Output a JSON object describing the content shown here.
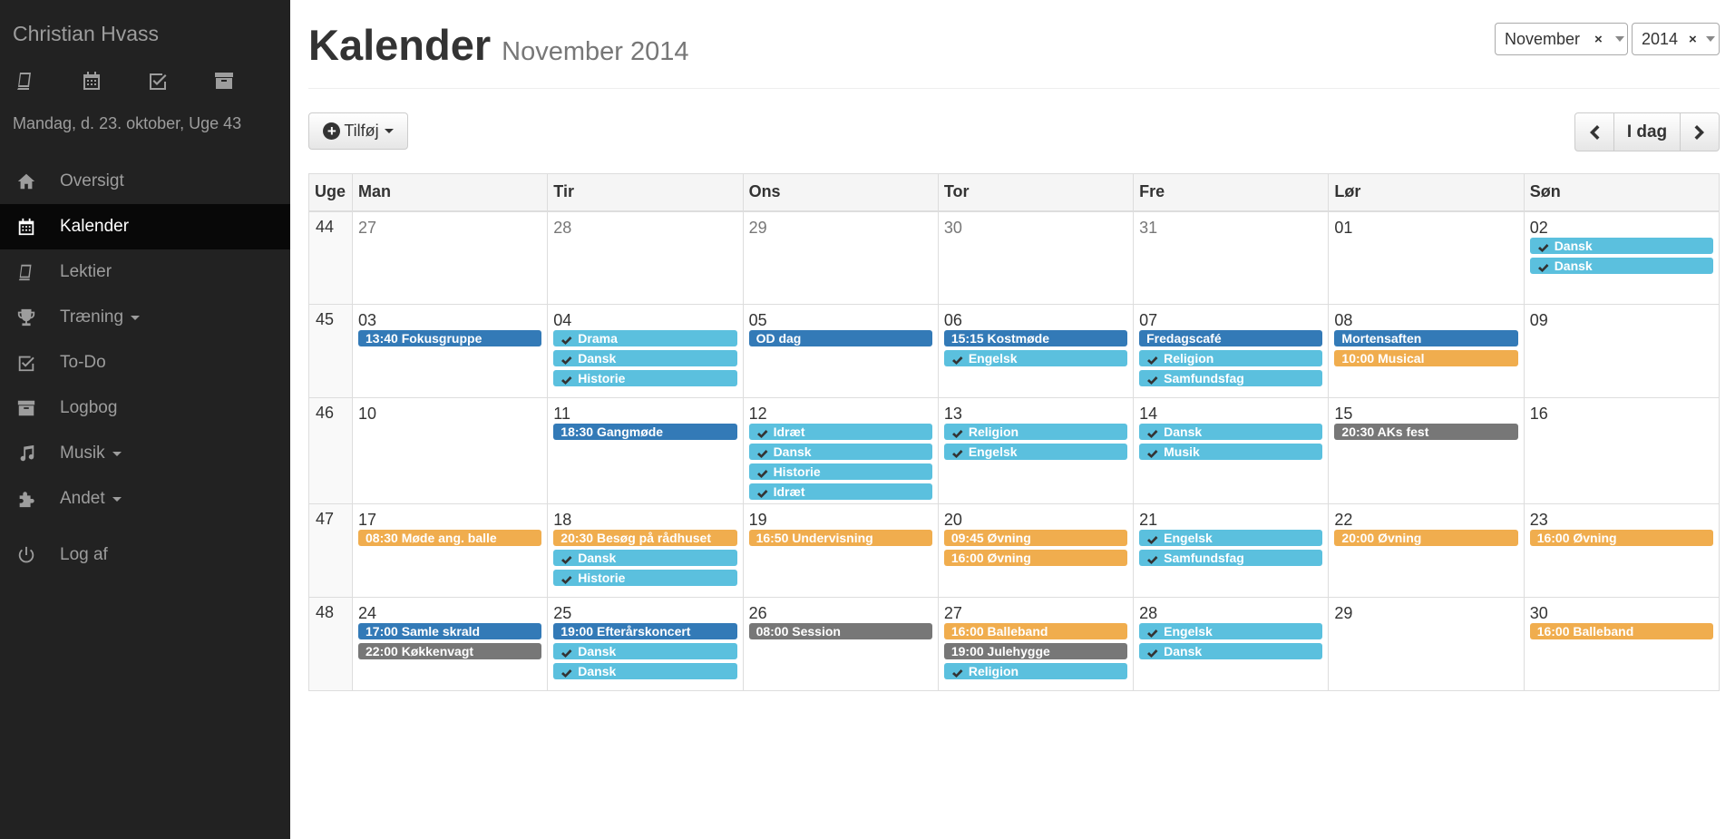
{
  "sidebar": {
    "user_name": "Christian Hvass",
    "quick_icons": [
      "book-icon",
      "calendar-icon",
      "check-square-icon",
      "archive-icon"
    ],
    "date_line": "Mandag, d. 23. oktober, Uge 43",
    "nav": [
      {
        "label": "Oversigt",
        "icon": "home-icon"
      },
      {
        "label": "Kalender",
        "icon": "calendar-icon",
        "active": true
      },
      {
        "label": "Lektier",
        "icon": "book-icon"
      },
      {
        "label": "Træning",
        "icon": "trophy-icon",
        "dropdown": true
      },
      {
        "label": "To-Do",
        "icon": "check-square-icon"
      },
      {
        "label": "Logbog",
        "icon": "archive-icon"
      },
      {
        "label": "Musik",
        "icon": "music-icon",
        "dropdown": true
      },
      {
        "label": "Andet",
        "icon": "puzzle-icon",
        "dropdown": true
      },
      {
        "label": "Log af",
        "icon": "power-icon"
      }
    ]
  },
  "header": {
    "title": "Kalender",
    "subtitle": "November 2014",
    "month_select": "November",
    "year_select": "2014",
    "clear_symbol": "×"
  },
  "toolbar": {
    "add_label": "Tilføj",
    "today_label": "I dag"
  },
  "calendar": {
    "headers": [
      "Uge",
      "Man",
      "Tir",
      "Ons",
      "Tor",
      "Fre",
      "Lør",
      "Søn"
    ],
    "weeks": [
      {
        "week": "44",
        "days": [
          {
            "d": "27",
            "muted": true,
            "events": []
          },
          {
            "d": "28",
            "muted": true,
            "events": []
          },
          {
            "d": "29",
            "muted": true,
            "events": []
          },
          {
            "d": "30",
            "muted": true,
            "events": []
          },
          {
            "d": "31",
            "muted": true,
            "events": []
          },
          {
            "d": "01",
            "events": []
          },
          {
            "d": "02",
            "events": [
              {
                "t": "Dansk",
                "c": "info",
                "check": true
              },
              {
                "t": "Dansk",
                "c": "info",
                "check": true
              }
            ]
          }
        ]
      },
      {
        "week": "45",
        "days": [
          {
            "d": "03",
            "events": [
              {
                "t": "13:40 Fokusgruppe",
                "c": "blue"
              }
            ]
          },
          {
            "d": "04",
            "events": [
              {
                "t": "Drama",
                "c": "info",
                "check": true
              },
              {
                "t": "Dansk",
                "c": "info",
                "check": true
              },
              {
                "t": "Historie",
                "c": "info",
                "check": true
              }
            ]
          },
          {
            "d": "05",
            "events": [
              {
                "t": "OD dag",
                "c": "blue"
              }
            ]
          },
          {
            "d": "06",
            "events": [
              {
                "t": "15:15 Kostmøde",
                "c": "blue"
              },
              {
                "t": "Engelsk",
                "c": "info",
                "check": true
              }
            ]
          },
          {
            "d": "07",
            "events": [
              {
                "t": "Fredagscafé",
                "c": "blue"
              },
              {
                "t": "Religion",
                "c": "info",
                "check": true
              },
              {
                "t": "Samfundsfag",
                "c": "info",
                "check": true
              }
            ]
          },
          {
            "d": "08",
            "events": [
              {
                "t": "Mortensaften",
                "c": "blue"
              },
              {
                "t": "10:00 Musical",
                "c": "orange"
              }
            ]
          },
          {
            "d": "09",
            "events": []
          }
        ]
      },
      {
        "week": "46",
        "days": [
          {
            "d": "10",
            "events": []
          },
          {
            "d": "11",
            "events": [
              {
                "t": "18:30 Gangmøde",
                "c": "blue"
              }
            ]
          },
          {
            "d": "12",
            "events": [
              {
                "t": "Idræt",
                "c": "info",
                "check": true
              },
              {
                "t": "Dansk",
                "c": "info",
                "check": true
              },
              {
                "t": "Historie",
                "c": "info",
                "check": true
              },
              {
                "t": "Idræt",
                "c": "info",
                "check": true
              }
            ]
          },
          {
            "d": "13",
            "events": [
              {
                "t": "Religion",
                "c": "info",
                "check": true
              },
              {
                "t": "Engelsk",
                "c": "info",
                "check": true
              }
            ]
          },
          {
            "d": "14",
            "events": [
              {
                "t": "Dansk",
                "c": "info",
                "check": true
              },
              {
                "t": "Musik",
                "c": "info",
                "check": true
              }
            ]
          },
          {
            "d": "15",
            "events": [
              {
                "t": "20:30 AKs fest",
                "c": "gray"
              }
            ]
          },
          {
            "d": "16",
            "events": []
          }
        ]
      },
      {
        "week": "47",
        "days": [
          {
            "d": "17",
            "events": [
              {
                "t": "08:30 Møde ang. balle",
                "c": "orange"
              }
            ]
          },
          {
            "d": "18",
            "events": [
              {
                "t": "20:30 Besøg på rådhuset",
                "c": "orange"
              },
              {
                "t": "Dansk",
                "c": "info",
                "check": true
              },
              {
                "t": "Historie",
                "c": "info",
                "check": true
              }
            ]
          },
          {
            "d": "19",
            "events": [
              {
                "t": "16:50 Undervisning",
                "c": "orange"
              }
            ]
          },
          {
            "d": "20",
            "events": [
              {
                "t": "09:45 Øvning",
                "c": "orange"
              },
              {
                "t": "16:00 Øvning",
                "c": "orange"
              }
            ]
          },
          {
            "d": "21",
            "events": [
              {
                "t": "Engelsk",
                "c": "info",
                "check": true
              },
              {
                "t": "Samfundsfag",
                "c": "info",
                "check": true
              }
            ]
          },
          {
            "d": "22",
            "events": [
              {
                "t": "20:00 Øvning",
                "c": "orange"
              }
            ]
          },
          {
            "d": "23",
            "events": [
              {
                "t": "16:00 Øvning",
                "c": "orange"
              }
            ]
          }
        ]
      },
      {
        "week": "48",
        "days": [
          {
            "d": "24",
            "events": [
              {
                "t": "17:00 Samle skrald",
                "c": "blue"
              },
              {
                "t": "22:00 Køkkenvagt",
                "c": "gray"
              }
            ]
          },
          {
            "d": "25",
            "events": [
              {
                "t": "19:00 Efterårskoncert",
                "c": "blue"
              },
              {
                "t": "Dansk",
                "c": "info",
                "check": true
              },
              {
                "t": "Dansk",
                "c": "info",
                "check": true
              }
            ]
          },
          {
            "d": "26",
            "events": [
              {
                "t": "08:00 Session",
                "c": "gray"
              }
            ]
          },
          {
            "d": "27",
            "events": [
              {
                "t": "16:00 Balleband",
                "c": "orange"
              },
              {
                "t": "19:00 Julehygge",
                "c": "gray"
              },
              {
                "t": "Religion",
                "c": "info",
                "check": true
              }
            ]
          },
          {
            "d": "28",
            "events": [
              {
                "t": "Engelsk",
                "c": "info",
                "check": true
              },
              {
                "t": "Dansk",
                "c": "info",
                "check": true
              }
            ]
          },
          {
            "d": "29",
            "events": []
          },
          {
            "d": "30",
            "events": [
              {
                "t": "16:00 Balleband",
                "c": "orange"
              }
            ]
          }
        ]
      }
    ]
  },
  "colors": {
    "sidebar_bg": "#222222",
    "active_bg": "#080808",
    "event_blue": "#337ab7",
    "event_info": "#5bc0de",
    "event_orange": "#f0ad4e",
    "event_gray": "#777777"
  }
}
